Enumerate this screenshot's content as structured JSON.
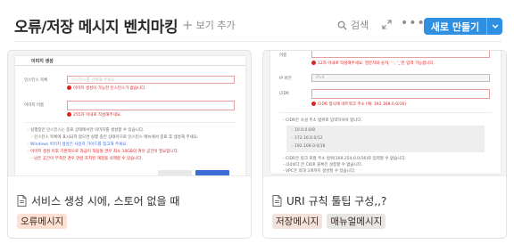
{
  "header": {
    "title": "오류/저장 메시지 벤치마킹",
    "add_view_label": "보기 추가",
    "search_label": "검색",
    "new_button_label": "새로 만들기"
  },
  "cards": [
    {
      "title": "서비스 생성 시에, 스토어 없을 때",
      "tags": [
        {
          "label": "오류메시지",
          "color": "#fde0d2"
        }
      ],
      "preview": {
        "heading": "이미지 생성",
        "label_instance": "인스턴스 목록",
        "select_placeholder": "인스턴스를 선택해 주세요",
        "err_instance": "이미지 생성이 가능한 인스턴스가 없습니다.",
        "label_name": "이미지 이름",
        "err_name": "255자 이내로 작성해주세요.",
        "notes": [
          "- 실행중인 인스턴스는 종료 상태에서만 이미지를 생성할 수 있습니다.",
          "- 인스턴스 목록에 표시되지 않으면 실행 중인 상태이므로 인스턴스 메뉴에서 종료 후 생성해 주세요.",
          "- Windows 이미지 생성은 사용자 가이드를 참고해 주세요.",
          "- 이미지 생성 이후 기본적으로 과금이 적용될 경우 최소 10GB의 여유 공간이 필요합니다.",
          "- 남은 공간이 부족한 경우 관련 조치된 계정을 삭제할 수 있습니다."
        ]
      }
    },
    {
      "title": "URI 규칙 툴팁 구성,,?",
      "tags": [
        {
          "label": "저장메시지",
          "color": "#f2e2d9"
        },
        {
          "label": "매뉴얼메시지",
          "color": "#e7e6e3"
        }
      ],
      "preview": {
        "label_name": "이름",
        "err_name": "12자 이내로 작성해주세요. 영문자와 숫자, '-', '_'만 입력 가능합니다.",
        "label_ip": "IP 버전",
        "ip_value": "IPv4",
        "label_cidr": "CIDR",
        "err_cidr": "CIDR 형식에 네트워크 주소 (예: 192.168.0.0/16)",
        "notes_title": "- CIDR은 사설 주소 범위로 입력하셔야 합니다.",
        "code_lines": [
          "- 10.0.0.0/8",
          "- 172.16.0.0/12",
          "- 192.168.0.0/16"
        ],
        "notes_more": [
          "- CIDR은 링크 로컬 주소 범위(169.254.0.0/16)로 입력할 수 없습니다.",
          "- /24보다 큰 CIDR 블록은 설정할 수 없습니다.",
          "- VPC은 최대 3개까지 생성할 수 있습니다."
        ]
      }
    }
  ],
  "colors": {
    "accent": "#2f8fe0",
    "error": "#dd2222"
  },
  "icons": [
    "plus-icon",
    "search-icon",
    "expand-icon",
    "more-icon",
    "chevron-down-icon",
    "page-icon"
  ]
}
